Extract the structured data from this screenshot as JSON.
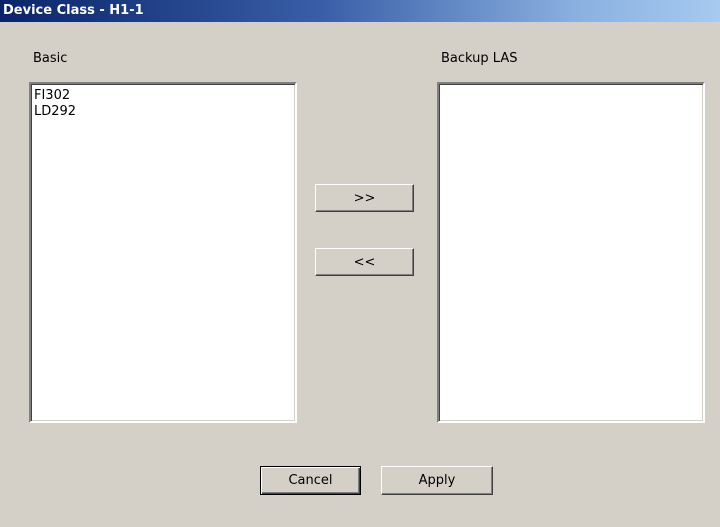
{
  "window": {
    "title": "Device Class - H1-1"
  },
  "left_panel": {
    "label": "Basic",
    "items": [
      "FI302",
      "LD292"
    ]
  },
  "right_panel": {
    "label": "Backup LAS",
    "items": []
  },
  "buttons": {
    "move_right": ">>",
    "move_left": "<<",
    "cancel": "Cancel",
    "apply": "Apply"
  }
}
